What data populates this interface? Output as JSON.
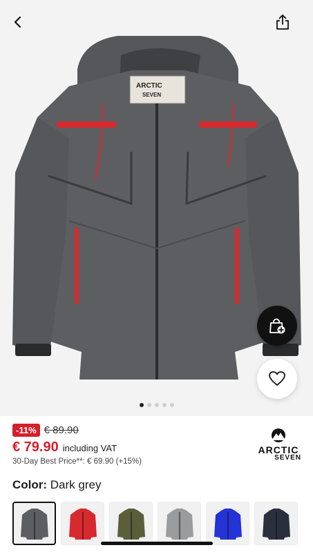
{
  "discount_badge": "-11%",
  "old_price": "€ 89.90",
  "price": "€ 79.90",
  "vat_note": "including VAT",
  "best_price": "30-Day Best Price**: € 69.90 (+15%)",
  "brand": {
    "line1": "ARCTIC",
    "line2": "SEVEN"
  },
  "color": {
    "label": "Color:",
    "value": "Dark grey"
  },
  "jacket_label": {
    "line1": "ARCTIC",
    "line2": "SEVEN"
  },
  "carousel": {
    "total": 5,
    "active_index": 0
  },
  "swatches": [
    {
      "name": "dark-grey",
      "color": "#5d5e61",
      "selected": true
    },
    {
      "name": "red",
      "color": "#d62a2f",
      "selected": false
    },
    {
      "name": "olive",
      "color": "#5a5f3a",
      "selected": false
    },
    {
      "name": "light-grey",
      "color": "#9a9b9d",
      "selected": false
    },
    {
      "name": "blue",
      "color": "#2433d6",
      "selected": false
    },
    {
      "name": "navy",
      "color": "#2a2f3d",
      "selected": false
    }
  ],
  "colors": {
    "accent_red": "#d51f2d",
    "hero_bg": "#f3f3f3"
  }
}
